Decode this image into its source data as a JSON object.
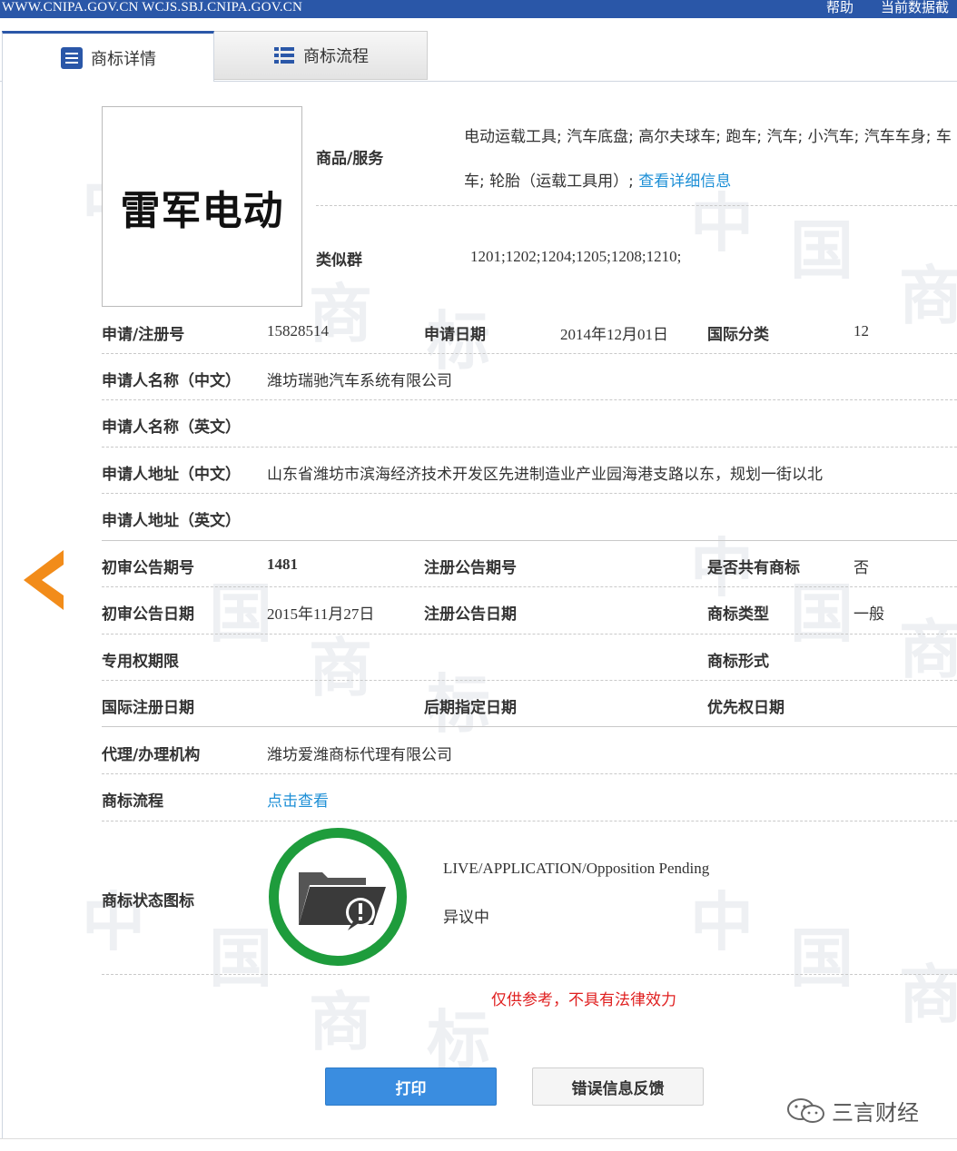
{
  "topbar": {
    "url": "WWW.CNIPA.GOV.CN WCJS.SBJ.CNIPA.GOV.CN",
    "help": "帮助",
    "current_data": "当前数据截"
  },
  "tabs": [
    {
      "label": "商标详情",
      "active": true
    },
    {
      "label": "商标流程",
      "active": false
    }
  ],
  "logo": {
    "text": "雷军电动"
  },
  "goods": {
    "label": "商品/服务",
    "line1": "电动运载工具; 汽车底盘; 高尔夫球车; 跑车; 汽车; 小汽车; 汽车车身; 车",
    "line2": "车; 轮胎（运载工具用）;",
    "detail_link": "查看详细信息"
  },
  "similar_group": {
    "label": "类似群",
    "value": "1201;1202;1204;1205;1208;1210;"
  },
  "fields": {
    "reg_no": {
      "label": "申请/注册号",
      "value": "15828514"
    },
    "apply_date": {
      "label": "申请日期",
      "value": "2014年12月01日"
    },
    "intl_class": {
      "label": "国际分类",
      "value": "12"
    },
    "applicant_cn": {
      "label": "申请人名称（中文）",
      "value": "潍坊瑞驰汽车系统有限公司"
    },
    "applicant_en": {
      "label": "申请人名称（英文）",
      "value": ""
    },
    "address_cn": {
      "label": "申请人地址（中文）",
      "value": "山东省潍坊市滨海经济技术开发区先进制造业产业园海港支路以东，规划一街以北"
    },
    "address_en": {
      "label": "申请人地址（英文）",
      "value": ""
    },
    "prelim_issue": {
      "label": "初审公告期号",
      "value": "1481"
    },
    "reg_issue": {
      "label": "注册公告期号",
      "value": ""
    },
    "shared": {
      "label": "是否共有商标",
      "value": "否"
    },
    "prelim_date": {
      "label": "初审公告日期",
      "value": "2015年11月27日"
    },
    "reg_date": {
      "label": "注册公告日期",
      "value": ""
    },
    "tm_type": {
      "label": "商标类型",
      "value": "一般"
    },
    "exclusive_period": {
      "label": "专用权期限",
      "value": ""
    },
    "tm_form": {
      "label": "商标形式",
      "value": ""
    },
    "intl_reg_date": {
      "label": "国际注册日期",
      "value": ""
    },
    "later_date": {
      "label": "后期指定日期",
      "value": ""
    },
    "priority_date": {
      "label": "优先权日期",
      "value": ""
    },
    "agent": {
      "label": "代理/办理机构",
      "value": "潍坊爱潍商标代理有限公司"
    },
    "process": {
      "label": "商标流程",
      "value": "点击查看"
    }
  },
  "status": {
    "label": "商标状态图标",
    "en": "LIVE/APPLICATION/Opposition Pending",
    "cn": "异议中",
    "ring_color": "#1e9c3c"
  },
  "notice": "仅供参考，不具有法律效力",
  "buttons": {
    "print": "打印",
    "feedback": "错误信息反馈"
  },
  "watermark_account": "三言财经",
  "colors": {
    "accent": "#2a57a8",
    "link": "#1d8fd6",
    "arrow": "#f28c1a",
    "notice": "#e02020"
  }
}
